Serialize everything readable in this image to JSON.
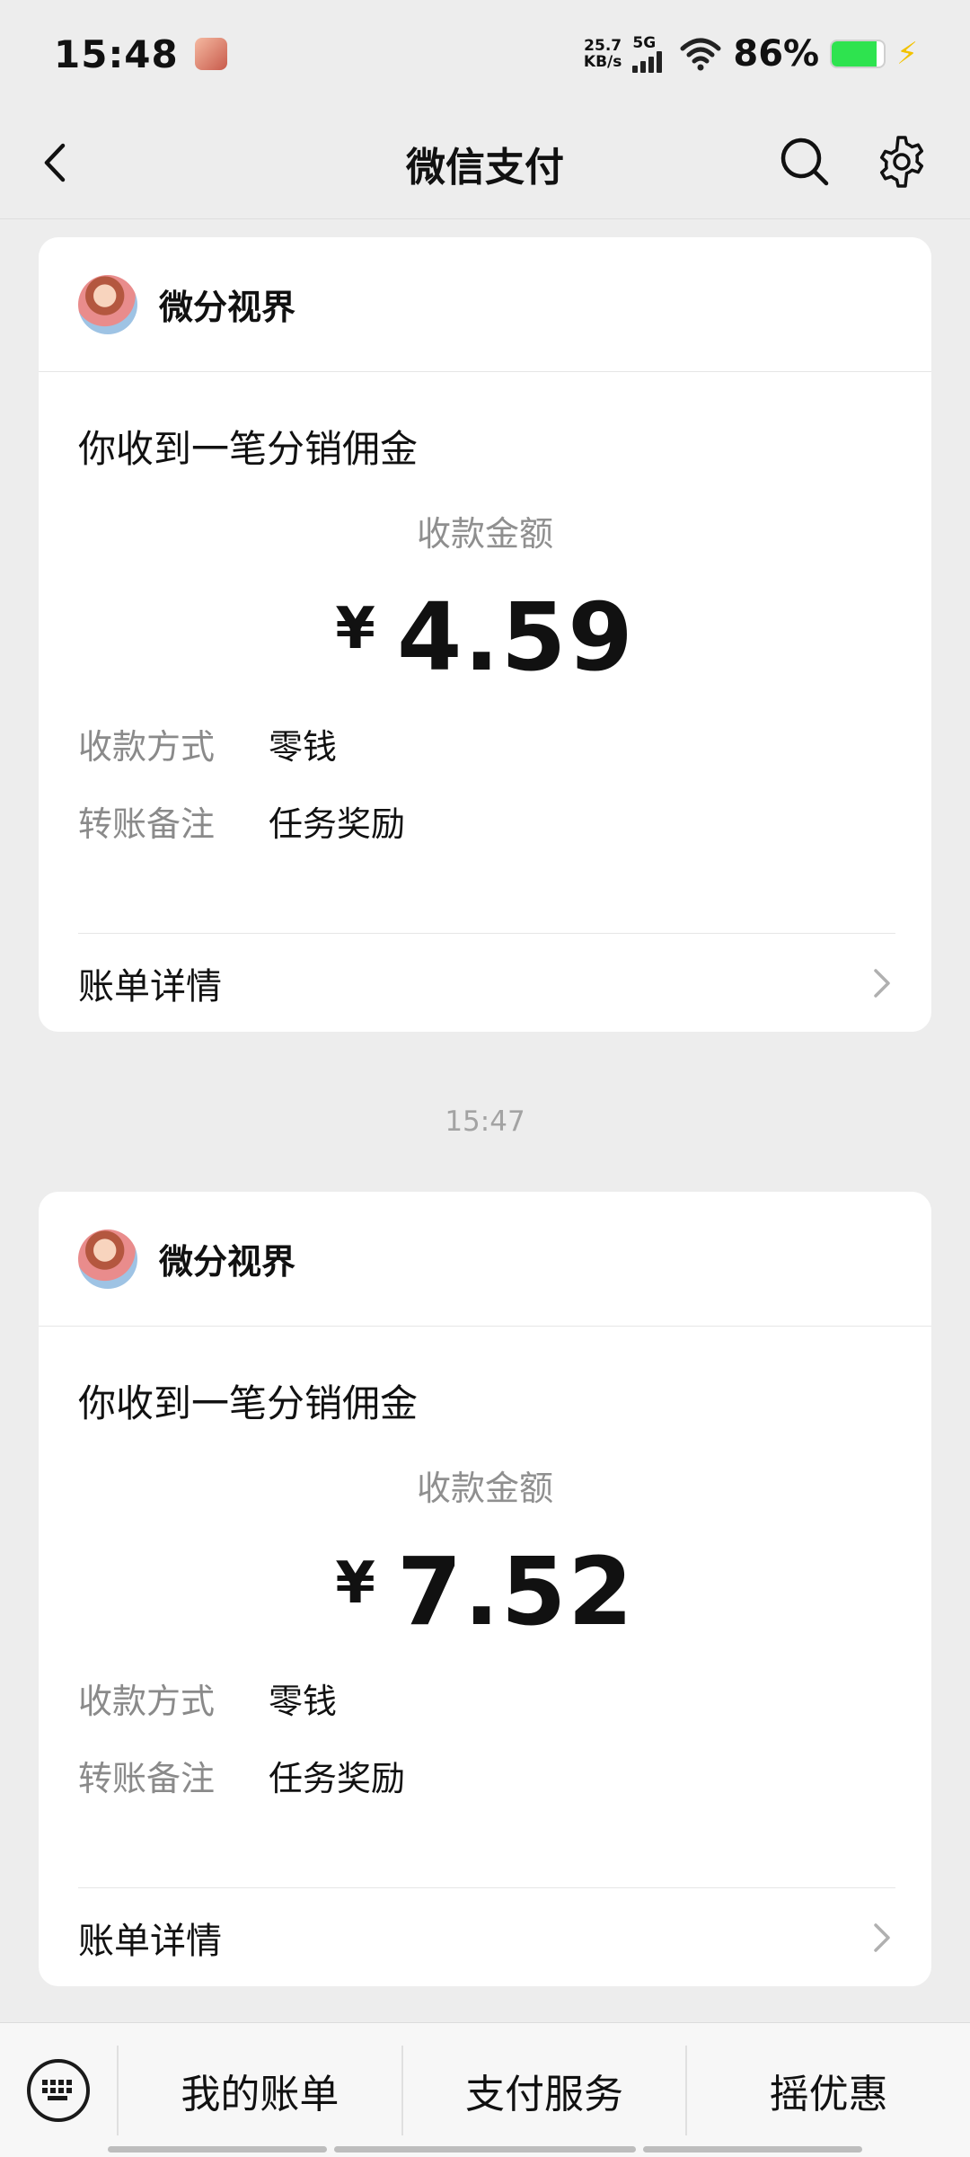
{
  "status_bar": {
    "time": "15:48",
    "net_speed_value": "25.7",
    "net_speed_unit": "KB/s",
    "network_type": "5G",
    "battery_percent": "86%",
    "battery_level": 0.86,
    "colors": {
      "battery": "#2ee34f",
      "charging": "#f2c200"
    }
  },
  "nav": {
    "title": "微信支付",
    "back_icon": "chevron-left-icon",
    "search_icon": "search-icon",
    "settings_icon": "gear-icon"
  },
  "cards": [
    {
      "merchant": "微分视界",
      "title": "你收到一笔分销佣金",
      "amount_label": "收款金额",
      "currency": "¥",
      "amount": "4.59",
      "rows": [
        {
          "label": "收款方式",
          "value": "零钱"
        },
        {
          "label": "转账备注",
          "value": "任务奖励"
        }
      ],
      "detail_label": "账单详情"
    },
    {
      "merchant": "微分视界",
      "title": "你收到一笔分销佣金",
      "amount_label": "收款金额",
      "currency": "¥",
      "amount": "7.52",
      "rows": [
        {
          "label": "收款方式",
          "value": "零钱"
        },
        {
          "label": "转账备注",
          "value": "任务奖励"
        }
      ],
      "detail_label": "账单详情"
    }
  ],
  "timestamp": "15:47",
  "bottom_menu": {
    "keyboard_icon": "keyboard-icon",
    "items": [
      "我的账单",
      "支付服务",
      "摇优惠"
    ]
  }
}
